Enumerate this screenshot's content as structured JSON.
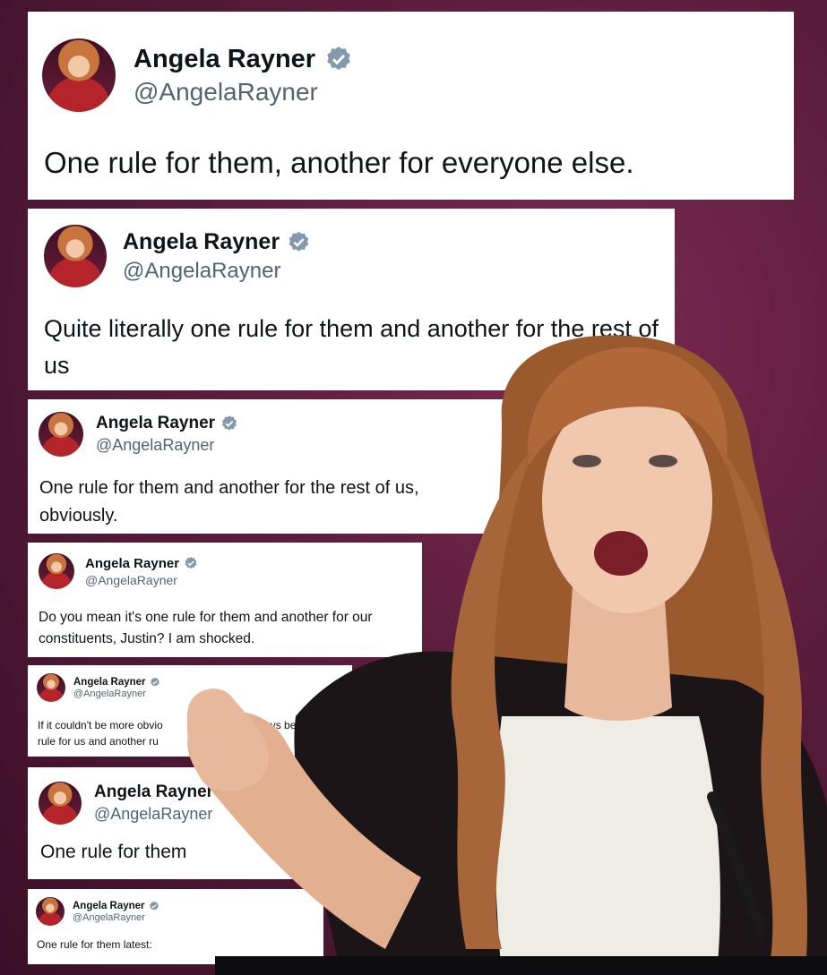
{
  "account": {
    "name": "Angela Rayner",
    "handle": "@AngelaRayner"
  },
  "tweets": [
    {
      "text": "One rule for them, another for everyone else."
    },
    {
      "text": "Quite literally one rule for them and another for the rest of us"
    },
    {
      "text": "One rule for them and another for the rest of us, obviously."
    },
    {
      "text": "Do you mean it's one rule for them and another for our constituents, Justin? I am shocked."
    },
    {
      "line1": "If it couldn't be more obvio",
      "line1b": "ys be o",
      "line2": "rule for us and another ru"
    },
    {
      "text": "One rule for them"
    },
    {
      "text": "One rule for them latest:"
    }
  ],
  "colors": {
    "background": "#5a1c3c",
    "verified": "#829aab"
  }
}
